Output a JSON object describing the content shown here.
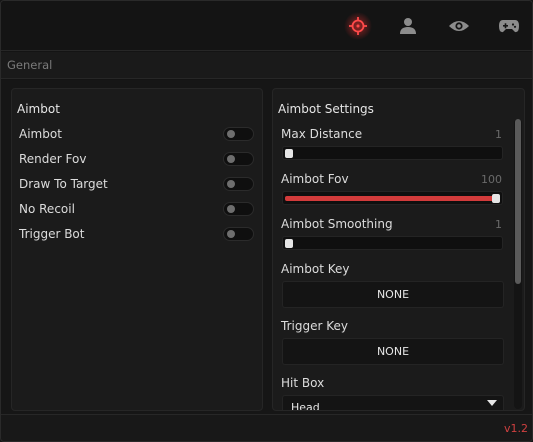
{
  "nav": {
    "tabs": [
      {
        "icon": "crosshair-icon",
        "active": true
      },
      {
        "icon": "user-icon",
        "active": false
      },
      {
        "icon": "eye-icon",
        "active": false
      },
      {
        "icon": "gamepad-icon",
        "active": false
      }
    ]
  },
  "section": {
    "title": "General"
  },
  "aimbot": {
    "title": "Aimbot",
    "toggles": [
      {
        "label": "Aimbot",
        "on": false
      },
      {
        "label": "Render Fov",
        "on": false
      },
      {
        "label": "Draw To Target",
        "on": false
      },
      {
        "label": "No Recoil",
        "on": false
      },
      {
        "label": "Trigger Bot",
        "on": false
      }
    ]
  },
  "settings": {
    "title": "Aimbot Settings",
    "max_distance": {
      "label": "Max Distance",
      "value": "1",
      "fraction": 0.0
    },
    "aimbot_fov": {
      "label": "Aimbot Fov",
      "value": "100",
      "fraction": 1.0
    },
    "aimbot_smoothing": {
      "label": "Aimbot Smoothing",
      "value": "1",
      "fraction": 0.0
    },
    "aimbot_key": {
      "label": "Aimbot Key",
      "value": "NONE"
    },
    "trigger_key": {
      "label": "Trigger Key",
      "value": "NONE"
    },
    "hit_box": {
      "label": "Hit Box",
      "value": "Head"
    }
  },
  "footer": {
    "version": "v1.2"
  },
  "colors": {
    "accent": "#d23b3b",
    "background": "#141414",
    "panel": "#1b1b1b"
  }
}
